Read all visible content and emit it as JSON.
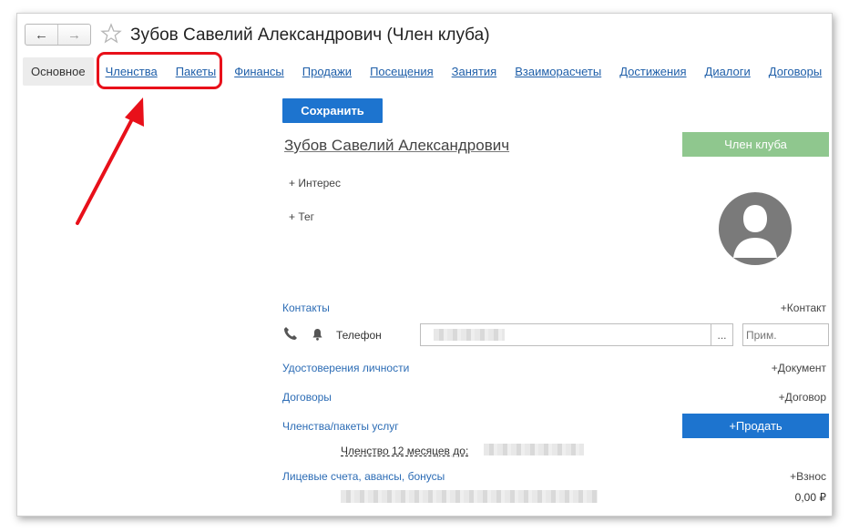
{
  "window": {
    "title": "Зубов Савелий Александрович (Член клуба)",
    "nav": {
      "back_icon": "arrow-left-icon",
      "forward_icon": "arrow-right-icon",
      "favorite_icon": "star-icon"
    }
  },
  "tabs": [
    {
      "label": "Основное",
      "active": true
    },
    {
      "label": "Членства"
    },
    {
      "label": "Пакеты"
    },
    {
      "label": "Финансы"
    },
    {
      "label": "Продажи"
    },
    {
      "label": "Посещения"
    },
    {
      "label": "Занятия"
    },
    {
      "label": "Взаиморасчеты"
    },
    {
      "label": "Достижения"
    },
    {
      "label": "Диалоги"
    },
    {
      "label": "Договоры"
    }
  ],
  "form": {
    "save_label": "Сохранить",
    "person_name": "Зубов Савелий Александрович",
    "status": "Член клуба",
    "add_interest": "+ Интерес",
    "add_tag": "+ Тег"
  },
  "contacts": {
    "title": "Контакты",
    "add_label": "+Контакт",
    "phone_label": "Телефон",
    "phone_value": "",
    "dots_label": "...",
    "note_placeholder": "Прим."
  },
  "documents": {
    "title": "Удостоверения личности",
    "add_label": "+Документ"
  },
  "contracts": {
    "title": "Договоры",
    "add_label": "+Договор"
  },
  "memberships": {
    "title": "Членства/пакеты услуг",
    "sell_label": "+Продать",
    "item": "Членство 12 месяцев до:"
  },
  "accounts": {
    "title": "Лицевые счета, авансы, бонусы",
    "add_label": "+Взнос",
    "balance": "0,00 ₽"
  },
  "colors": {
    "link": "#1f5fa9",
    "primary_button": "#1d74cf",
    "status_badge": "#8fc78e",
    "highlight": "#e8101a"
  }
}
